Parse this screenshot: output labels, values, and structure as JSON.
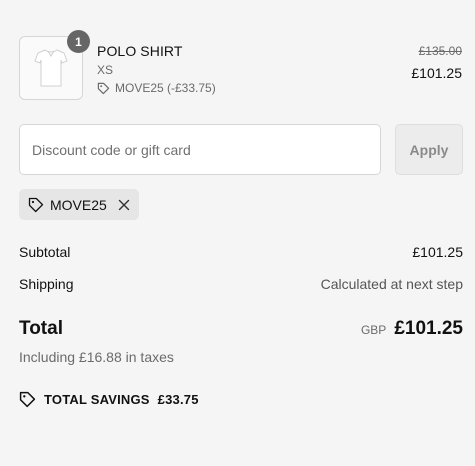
{
  "line_item": {
    "quantity": "1",
    "name": "POLO SHIRT",
    "variant": "XS",
    "discount_label": "MOVE25 (-£33.75)",
    "original_price": "£135.00",
    "price": "£101.25",
    "image_icon": "tshirt-icon"
  },
  "discount": {
    "placeholder": "Discount code or gift card",
    "value": "",
    "apply_label": "Apply",
    "applied_code": "MOVE25",
    "tag_icon": "tag-icon",
    "remove_icon": "close-icon"
  },
  "summary": {
    "subtotal_label": "Subtotal",
    "subtotal_value": "£101.25",
    "shipping_label": "Shipping",
    "shipping_value": "Calculated at next step",
    "total_label": "Total",
    "currency": "GBP",
    "total_value": "£101.25",
    "tax_note": "Including £16.88 in taxes",
    "savings_label": "TOTAL SAVINGS",
    "savings_value": "£33.75"
  },
  "colors": {
    "background": "#f5f5f5",
    "text": "#1a1a1a",
    "muted": "#6b6b6b",
    "badge": "#666666"
  }
}
